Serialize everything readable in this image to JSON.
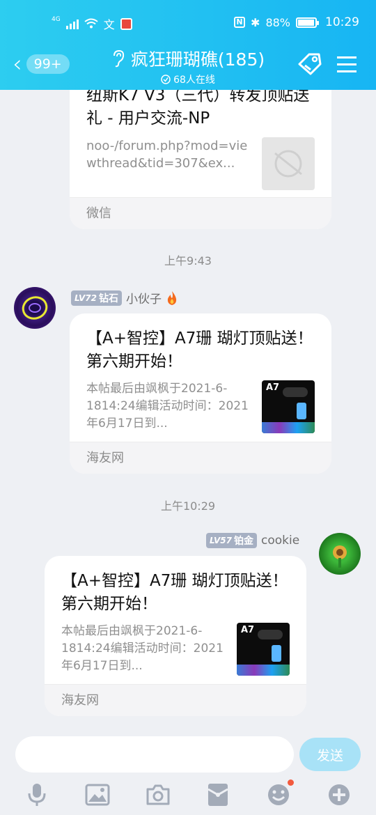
{
  "status_bar": {
    "network": "4G",
    "battery": "88%",
    "time": "10:29"
  },
  "header": {
    "unread_badge": "99+",
    "group_title": "疯狂珊瑚礁(185)",
    "online_count": "68人在线"
  },
  "messages": [
    {
      "card_title": "纽斯K7 V3（三代）转发顶贴送礼 - 用户交流-NP",
      "card_desc": "noo-/forum.php?mod=viewthread&tid=307&ex...",
      "source": "微信"
    },
    {
      "time": "上午9:43",
      "sender_level": "72",
      "sender_rank": "钻石",
      "sender_name": "小伙子",
      "card_title": "【A+智控】A7珊 瑚灯顶贴送！第六期开始！",
      "card_desc": "本帖最后由飒枫于2021-6-1814:24编辑活动时间：2021年6月17日到...",
      "source": "海友网",
      "thumb_text": "A7"
    },
    {
      "time": "上午10:29",
      "sender_level": "57",
      "sender_rank": "铂金",
      "sender_name": "cookie",
      "card_title": "【A+智控】A7珊 瑚灯顶贴送！第六期开始！",
      "card_desc": "本帖最后由飒枫于2021-6-1814:24编辑活动时间：2021年6月17日到...",
      "source": "海友网",
      "thumb_text": "A7"
    }
  ],
  "input": {
    "placeholder": "",
    "send_label": "发送"
  },
  "toolbar": [
    "mic-icon",
    "image-icon",
    "camera-icon",
    "red-packet-icon",
    "emoji-icon",
    "plus-icon"
  ]
}
